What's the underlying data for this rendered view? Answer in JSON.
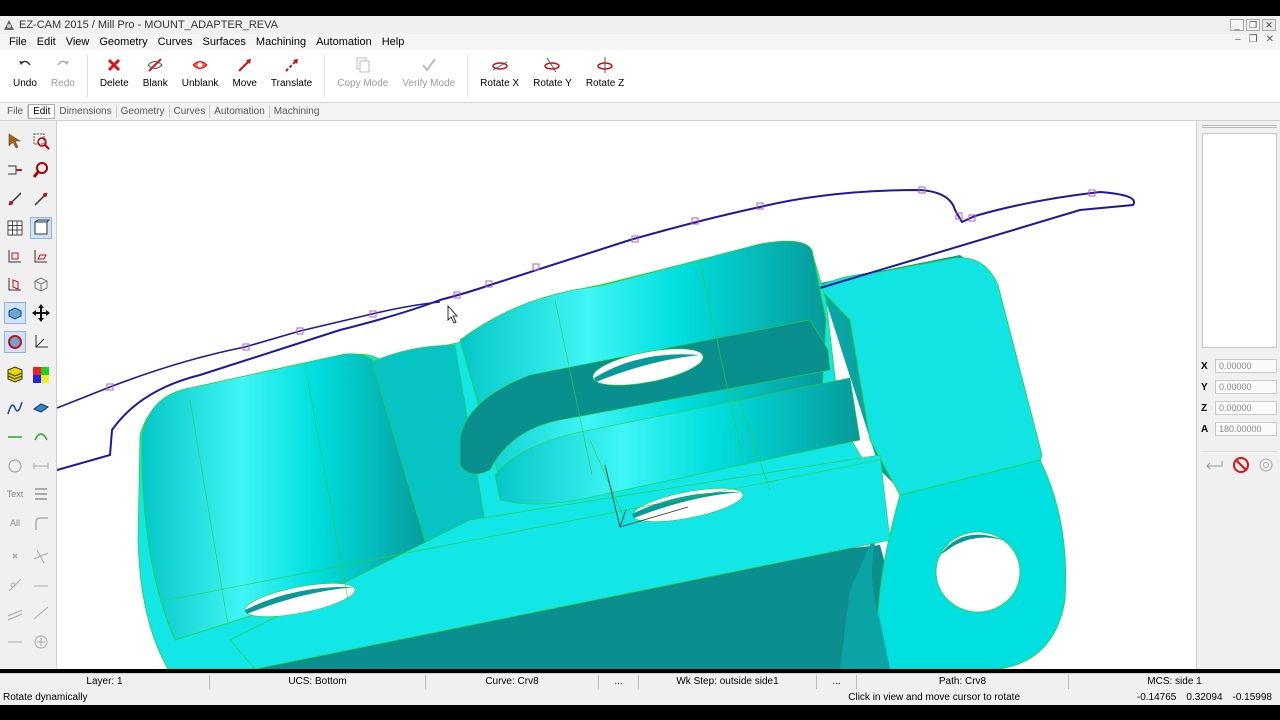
{
  "titlebar": {
    "title": "EZ-CAM 2015 / Mill Pro - MOUNT_ADAPTER_REVA",
    "minimize": "_",
    "restore": "❐",
    "close": "✕"
  },
  "menu": {
    "items": [
      "File",
      "Edit",
      "View",
      "Geometry",
      "Curves",
      "Surfaces",
      "Machining",
      "Automation",
      "Help"
    ],
    "mdi": [
      "–",
      "❐",
      "✕"
    ]
  },
  "ribbon": {
    "buttons": [
      {
        "label": "Undo",
        "icon": "undo-icon",
        "enabled": true
      },
      {
        "label": "Redo",
        "icon": "redo-icon",
        "enabled": false
      },
      {
        "label": "Delete",
        "icon": "delete-icon",
        "enabled": true
      },
      {
        "label": "Blank",
        "icon": "blank-icon",
        "enabled": true
      },
      {
        "label": "Unblank",
        "icon": "unblank-icon",
        "enabled": true
      },
      {
        "label": "Move",
        "icon": "move-icon",
        "enabled": true
      },
      {
        "label": "Translate",
        "icon": "translate-icon",
        "enabled": true
      },
      {
        "label": "Copy Mode",
        "icon": "copy-mode-icon",
        "enabled": false
      },
      {
        "label": "Verify Mode",
        "icon": "verify-mode-icon",
        "enabled": false
      },
      {
        "label": "Rotate X",
        "icon": "rotate-x-icon",
        "enabled": true
      },
      {
        "label": "Rotate Y",
        "icon": "rotate-y-icon",
        "enabled": true
      },
      {
        "label": "Rotate Z",
        "icon": "rotate-z-icon",
        "enabled": true
      }
    ]
  },
  "tabs": [
    "File",
    "Edit",
    "Dimensions",
    "Geometry",
    "Curves",
    "Automation",
    "Machining"
  ],
  "active_tab": "Edit",
  "left_toolbar": {
    "text_label": "Text",
    "all_label": "All"
  },
  "coords": {
    "x_label": "X",
    "x": "0.00000",
    "y_label": "Y",
    "y": "0.00000",
    "z_label": "Z",
    "z": "0.00000",
    "a_label": "A",
    "a": "180.00000"
  },
  "status": {
    "layer": "Layer: 1",
    "ucs": "UCS: Bottom",
    "curve": "Curve: Crv8",
    "ellipsis1": "...",
    "wkstep": "Wk Step: outside side1",
    "ellipsis2": "...",
    "path": "Path: Crv8",
    "mcs": "MCS: side 1",
    "hint_left": "Rotate dynamically",
    "hint_center": "Click in view and move cursor to rotate",
    "cursor_x": "-0.14765",
    "cursor_y": "0.32094",
    "cursor_z": "-0.15998"
  },
  "colors": {
    "part": "#00e0e0",
    "part_dark": "#0aa8a8",
    "edge": "#2bd12b",
    "curve": "#1a1aa0",
    "points": "#b05cc8"
  }
}
